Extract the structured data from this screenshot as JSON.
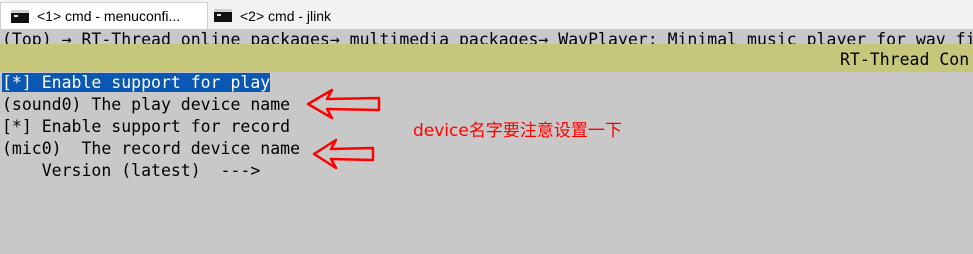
{
  "tabs": [
    {
      "label": "<1> cmd - menuconfi...",
      "icon": "cmd-icon",
      "active": true
    },
    {
      "label": "<2> cmd - jlink",
      "icon": "cmd-icon",
      "active": false
    }
  ],
  "terminal": {
    "breadcrumb": "(Top) → RT-Thread online packages→ multimedia packages→ WavPlayer: Minimal music player for wav fi",
    "title_bar": "RT-Thread Con",
    "menu_items": [
      {
        "text": "[*] Enable support for play",
        "selected": true
      },
      {
        "text": "(sound0) The play device name",
        "selected": false
      },
      {
        "text": "[*] Enable support for record",
        "selected": false
      },
      {
        "text": "(mic0)  The record device name",
        "selected": false
      },
      {
        "text": "    Version (latest)  --->",
        "selected": false
      }
    ]
  },
  "annotation": {
    "text": "device名字要注意设置一下",
    "color": "#ff0000"
  },
  "colors": {
    "terminal_bg": "#c8c8c8",
    "title_band": "#c6c77a",
    "selection": "#0b57b4",
    "arrow": "#ff0000"
  }
}
